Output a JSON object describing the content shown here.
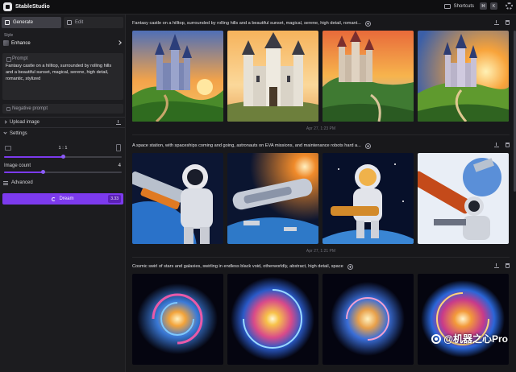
{
  "app": {
    "title": "StableStudio"
  },
  "topbar": {
    "shortcuts_label": "Shortcuts",
    "keys": [
      "⌘",
      "K"
    ]
  },
  "sidebar": {
    "tabs": [
      {
        "label": "Generate",
        "active": true
      },
      {
        "label": "Edit",
        "active": false
      }
    ],
    "style_label": "Style",
    "style_value": "Enhance",
    "prompt_label": "Prompt",
    "prompt_text": "Fantasy castle on a hilltop, surrounded by rolling hills and a beautiful sunset, magical, serene, high detail, romantic, stylized",
    "negative_prompt_label": "Negative prompt",
    "upload_label": "Upload image",
    "settings_label": "Settings",
    "aspect_ratio": "1 : 1",
    "aspect_ratio_slider_fraction": 0.5,
    "image_count_label": "Image count",
    "image_count_value": "4",
    "image_count_slider_fraction": 0.33,
    "advanced_label": "Advanced",
    "dream_label": "Dream",
    "dream_cost": "3.33"
  },
  "batches": [
    {
      "prompt": "Fantasy castle on a hilltop, surrounded by rolling hills and a beautiful sunset, magical, serene, high detail, romant...",
      "timestamp": "Apr 27, 1:23 PM",
      "theme": "castle"
    },
    {
      "prompt": "A space station, with spaceships coming and going, astronauts on EVA missions, and maintenance robots hard a...",
      "timestamp": "Apr 27, 1:21 PM",
      "theme": "space"
    },
    {
      "prompt": "Cosmic swirl of stars and galaxies, swirling in endless black void, otherworldly, abstract, high detail, space",
      "timestamp": "",
      "theme": "galaxy"
    }
  ],
  "watermark": {
    "text": "@机器之心Pro"
  },
  "colors": {
    "accent": "#7c3aed",
    "background": "#18181b",
    "sidebar": "#1c1c1f",
    "panel": "#27272a"
  },
  "icons": [
    "logo-icon",
    "keyboard-icon",
    "settings-gear-icon",
    "generate-icon",
    "edit-icon",
    "chevron-right-icon",
    "prompt-icon",
    "caret-icon",
    "upload-icon",
    "aspect-ratio-icon",
    "advanced-sliders-icon",
    "dream-icon",
    "add-circle-icon",
    "download-icon",
    "trash-icon"
  ]
}
